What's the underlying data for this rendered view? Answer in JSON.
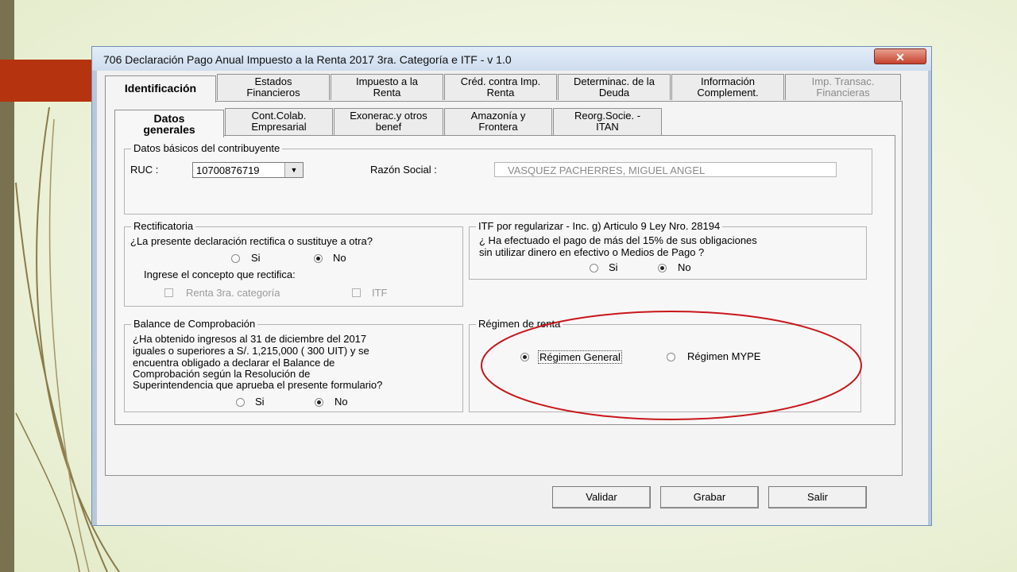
{
  "window": {
    "title": "706 Declaración Pago Anual Impuesto a la Renta 2017 3ra. Categoría e ITF - v 1.0",
    "close_label": "✕"
  },
  "tabs": [
    {
      "line1": "Identificación",
      "line2": ""
    },
    {
      "line1": "Estados",
      "line2": "Financieros"
    },
    {
      "line1": "Impuesto a la",
      "line2": "Renta"
    },
    {
      "line1": "Créd. contra Imp.",
      "line2": "Renta"
    },
    {
      "line1": "Determinac. de la",
      "line2": "Deuda"
    },
    {
      "line1": "Información",
      "line2": "Complement."
    },
    {
      "line1": "Imp. Transac.",
      "line2": "Financieras"
    }
  ],
  "subtabs": [
    {
      "line1": "Datos",
      "line2": "generales"
    },
    {
      "line1": "Cont.Colab.",
      "line2": "Empresarial"
    },
    {
      "line1": "Exonerac.y otros",
      "line2": "benef"
    },
    {
      "line1": "Amazonía y",
      "line2": "Frontera"
    },
    {
      "line1": "Reorg.Socie. -",
      "line2": "ITAN"
    }
  ],
  "datos_basicos": {
    "legend": "Datos básicos del contribuyente",
    "ruc_label": "RUC :",
    "ruc_value": "10700876719",
    "razon_label": "Razón Social :",
    "razon_value": "VASQUEZ PACHERRES, MIGUEL ANGEL"
  },
  "rectificatoria": {
    "legend": "Rectificatoria",
    "question": "¿La presente declaración rectifica o sustituye a otra?",
    "si": "Si",
    "no": "No",
    "concepto": "Ingrese el concepto que rectifica:",
    "renta3": "Renta 3ra. categoría",
    "itf": "ITF"
  },
  "itf_regularizar": {
    "legend": "ITF por regularizar -  Inc. g) Articulo 9 Ley Nro. 28194",
    "q1": "¿ Ha efectuado el pago de más del 15% de sus obligaciones",
    "q2": "sin utilizar dinero en efectivo o Medios de Pago ?",
    "si": "Si",
    "no": "No"
  },
  "balance": {
    "legend": "Balance de Comprobación",
    "lines": [
      "¿Ha obtenido ingresos al 31 de diciembre del 2017",
      "iguales o superiores a S/. 1,215,000 ( 300 UIT) y se",
      "encuentra obligado a declarar el Balance de",
      "Comprobación según la Resolución de",
      "Superintendencia que aprueba el presente formulario?"
    ],
    "si": "Si",
    "no": "No"
  },
  "regimen": {
    "legend": "Régimen de renta",
    "general": "Régimen General",
    "mype": "Régimen MYPE"
  },
  "buttons": {
    "validar": "Validar",
    "grabar": "Grabar",
    "salir": "Salir"
  },
  "colors": {
    "annotation": "#c8161b",
    "slide_accent": "#b5330e"
  }
}
